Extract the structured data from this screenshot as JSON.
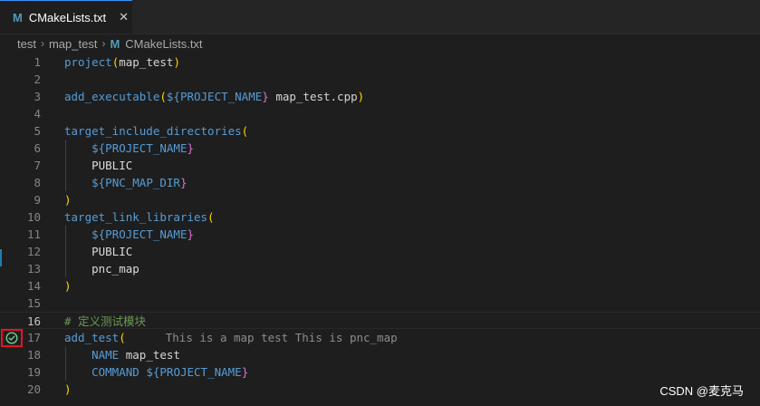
{
  "tab": {
    "icon": "M",
    "title": "CMakeLists.txt",
    "close": "✕"
  },
  "breadcrumb": {
    "parts": [
      "test",
      "map_test"
    ],
    "file_icon": "M",
    "file": "CMakeLists.txt",
    "sep": "›"
  },
  "lines": [
    {
      "n": "1"
    },
    {
      "n": "2"
    },
    {
      "n": "3"
    },
    {
      "n": "4"
    },
    {
      "n": "5"
    },
    {
      "n": "6"
    },
    {
      "n": "7"
    },
    {
      "n": "8"
    },
    {
      "n": "9"
    },
    {
      "n": "10"
    },
    {
      "n": "11"
    },
    {
      "n": "12"
    },
    {
      "n": "13"
    },
    {
      "n": "14"
    },
    {
      "n": "15"
    },
    {
      "n": "16"
    },
    {
      "n": "17"
    },
    {
      "n": "18"
    },
    {
      "n": "19"
    },
    {
      "n": "20"
    }
  ],
  "code": {
    "l1_fn": "project",
    "l1_arg": "map_test",
    "l3_fn": "add_executable",
    "l3_var": "PROJECT_NAME",
    "l3_rest": " map_test.cpp",
    "l5_fn": "target_include_directories",
    "l6_var": "PROJECT_NAME",
    "l7_kw": "PUBLIC",
    "l8_var": "PNC_MAP_DIR",
    "l10_fn": "target_link_libraries",
    "l11_var": "PROJECT_NAME",
    "l12_kw": "PUBLIC",
    "l13_kw": "pnc_map",
    "l16_comment": "# 定义测试模块",
    "l17_fn": "add_test",
    "l17_ghost": "This is a map test This is pnc_map",
    "l18_kw": "NAME",
    "l18_arg": " map_test",
    "l19_kw": "COMMAND",
    "l19_var": "PROJECT_NAME"
  },
  "icons": {
    "test_status": "check-circle-icon",
    "colors": {
      "accent": "#3794ff",
      "pass": "#73c991",
      "highlight_box": "#e81123"
    }
  },
  "watermark": "CSDN @麦克马"
}
